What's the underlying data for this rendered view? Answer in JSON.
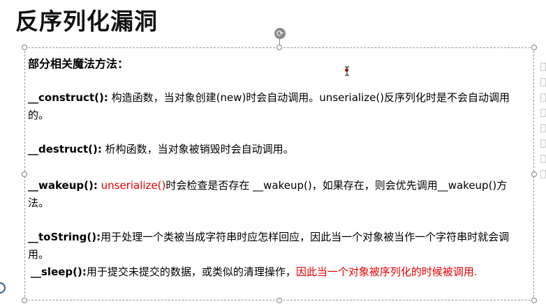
{
  "slide": {
    "title": "反序列化漏洞",
    "heading": "部分相关魔法方法：",
    "p1_fn": "__construct():",
    "p1_text": " 构造函数，当对象创建(new)时会自动调用。unserialize()反序列化时是不会自动调用的。",
    "p2_fn": "__destruct():",
    "p2_text": " 析构函数，当对象被销毁时会自动调用。",
    "p3_fn": "__wakeup():",
    "p3_red": " unserialize()",
    "p3_text": "时会检查是否存在 __wakeup()，如果存在，则会优先调用__wakeup()方法。",
    "p4_fn": "__toString():",
    "p4_text": "用于处理一个类被当成字符串时应怎样回应，因此当一个对象被当作一个字符串时就会调用。",
    "p5_fn": "__sleep():",
    "p5_text": "用于提交未提交的数据，或类似的清理操作，",
    "p5_red": "因此当一个对象被序列化的时候被调用."
  },
  "colors": {
    "accent_red": "#e60000",
    "handle_border": "#808080"
  }
}
